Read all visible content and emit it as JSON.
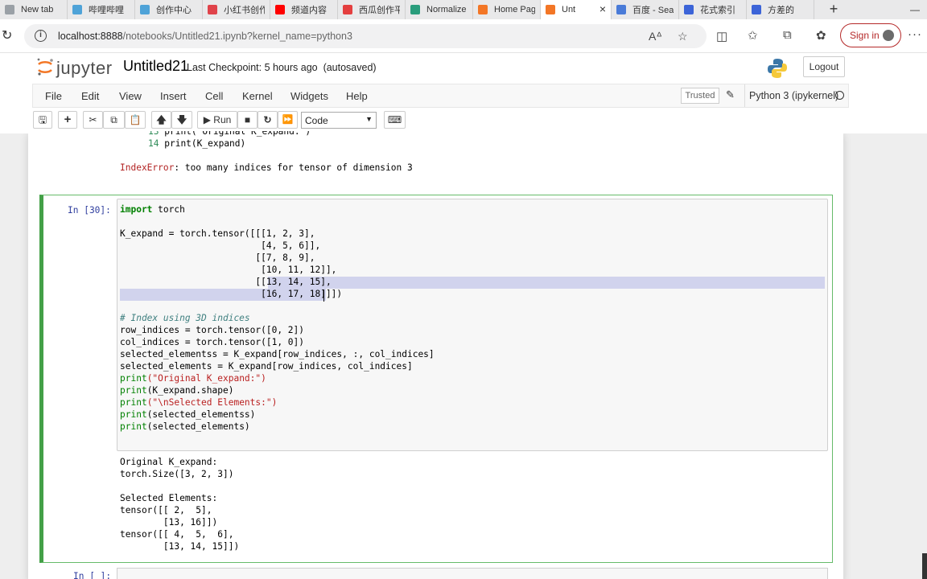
{
  "browser": {
    "tabs": [
      {
        "label": "New tab",
        "icon": "new-tab-favicon",
        "color": "#9aa0a6"
      },
      {
        "label": "哔哩哔哩",
        "icon": "bilibili-favicon",
        "color": "#4fa3d8"
      },
      {
        "label": "创作中心",
        "icon": "bilibili-favicon",
        "color": "#4fa3d8"
      },
      {
        "label": "小红书创作",
        "icon": "xiaohongshu-favicon",
        "color": "#e0434a"
      },
      {
        "label": "频道内容",
        "icon": "youtube-favicon",
        "color": "#ff0000"
      },
      {
        "label": "西瓜创作平",
        "icon": "xigua-favicon",
        "color": "#e43f3f"
      },
      {
        "label": "Normalize",
        "icon": "chatgpt-favicon",
        "color": "#2a9d7c"
      },
      {
        "label": "Home Page",
        "icon": "jupyter-favicon",
        "color": "#f37626"
      },
      {
        "label": "Unt",
        "icon": "jupyter-book-favicon",
        "color": "#f37626",
        "active": true
      },
      {
        "label": "百度 - Sea",
        "icon": "search-favicon",
        "color": "#4a7bd8"
      },
      {
        "label": "花式索引",
        "icon": "baidu-favicon",
        "color": "#3c64d8"
      },
      {
        "label": "方差的",
        "icon": "baidu-favicon",
        "color": "#3c64d8"
      }
    ],
    "url_host": "localhost:8888",
    "url_path": "/notebooks/Untitled21.ipynb?kernel_name=python3",
    "signin_label": "Sign in",
    "more_dots": "···"
  },
  "jupyter": {
    "logo_text": "jupyter",
    "notebook_title": "Untitled21",
    "checkpoint": "Last Checkpoint: 5 hours ago",
    "autosaved": "(autosaved)",
    "logout_label": "Logout",
    "menus": [
      "File",
      "Edit",
      "View",
      "Insert",
      "Cell",
      "Kernel",
      "Widgets",
      "Help"
    ],
    "trusted_label": "Trusted",
    "kernel_name": "Python 3 (ipykernel)",
    "run_label": "Run",
    "cell_type": "Code"
  },
  "prev_output": {
    "line13_num": "13",
    "line13_code": "print(\"Original K_expand:\")",
    "line14_num": "14",
    "line14_code": "print(K_expand)",
    "error_name": "IndexError",
    "error_msg": ": too many indices for tensor of dimension 3"
  },
  "cell": {
    "prompt": "In [30]:",
    "code": {
      "l1_kw": "import",
      "l1_rest": " torch",
      "l3": "K_expand = torch.tensor([[[1, 2, 3],",
      "l4": "                          [4, 5, 6]],",
      "l5": "                         [[7, 8, 9],",
      "l6": "                          [10, 11, 12]],",
      "l7": "                         [[13, 14, 15],",
      "l8": "                          [16, 17, 18]]])",
      "l10": "# Index using 3D indices",
      "l11": "row_indices = torch.tensor([0, 2])",
      "l12": "col_indices = torch.tensor([1, 0])",
      "l13": "selected_elementss = K_expand[row_indices, :, col_indices]",
      "l14": "selected_elements = K_expand[row_indices, col_indices]",
      "l15_fn": "print",
      "l15_str": "(\"Original K_expand:\")",
      "l16_fn": "print",
      "l16_rest": "(K_expand.shape)",
      "l17_fn": "print",
      "l17_str": "(\"\\nSelected Elements:\")",
      "l18_fn": "print",
      "l18_rest": "(selected_elementss)",
      "l19_fn": "print",
      "l19_rest": "(selected_elements)"
    },
    "output": {
      "o1": "Original K_expand:",
      "o2": "torch.Size([3, 2, 3])",
      "o4": "Selected Elements:",
      "o5": "tensor([[ 2,  5],",
      "o6": "        [13, 16]])",
      "o7": "tensor([[ 4,  5,  6],",
      "o8": "        [13, 14, 15]])"
    }
  },
  "next_cell": {
    "prompt": "In [ ]:"
  }
}
